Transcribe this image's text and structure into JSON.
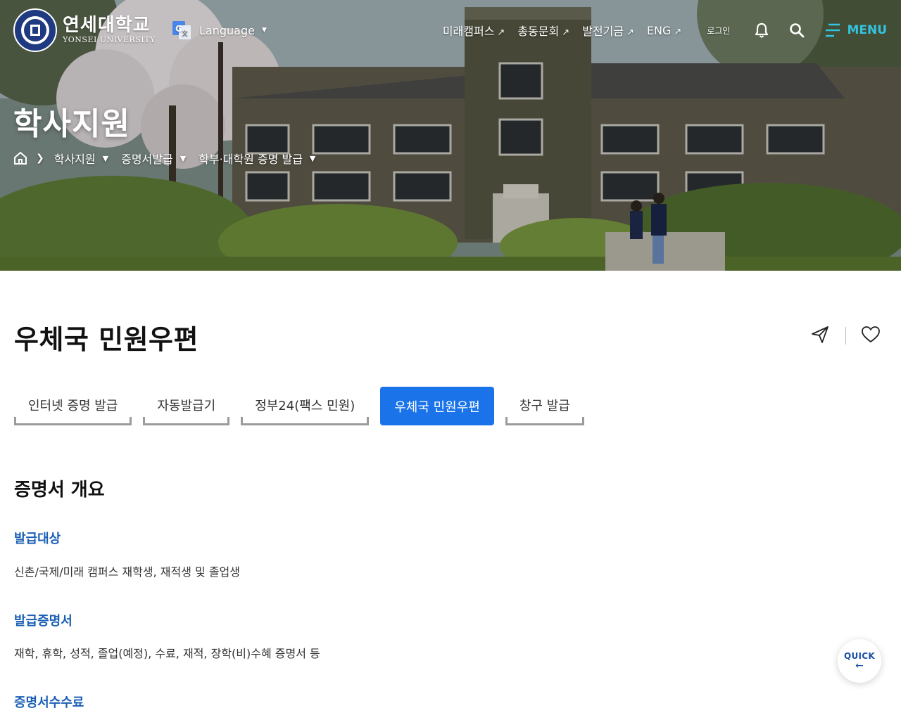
{
  "header": {
    "logo_ko": "연세대학교",
    "logo_en": "YONSEI UNIVERSITY",
    "language_label": "Language",
    "util_links": [
      {
        "label": "미래캠퍼스"
      },
      {
        "label": "총동문회"
      },
      {
        "label": "발전기금"
      },
      {
        "label": "ENG"
      }
    ],
    "login_label": "로그인",
    "menu_label": "MENU",
    "external_arrow": "↗"
  },
  "hero": {
    "title": "학사지원",
    "breadcrumb": [
      "학사지원",
      "증명서발급",
      "학부·대학원 증명 발급"
    ]
  },
  "page": {
    "title": "우체국 민원우편"
  },
  "tabs": [
    {
      "label": "인터넷 증명 발급",
      "active": false
    },
    {
      "label": "자동발급기",
      "active": false
    },
    {
      "label": "정부24(팩스 민원)",
      "active": false
    },
    {
      "label": "우체국 민원우편",
      "active": true
    },
    {
      "label": "창구 발급",
      "active": false
    }
  ],
  "content": {
    "section_title": "증명서 개요",
    "blocks": [
      {
        "heading": "발급대상",
        "text": "신촌/국제/미래 캠퍼스 재학생, 재적생 및 졸업생"
      },
      {
        "heading": "발급증명서",
        "text": "재학, 휴학, 성적, 졸업(예정), 수료, 재적, 장학(비)수혜 증명서 등"
      },
      {
        "heading": "증명서수수료",
        "text": ""
      }
    ]
  },
  "quick": {
    "label": "QUICK",
    "arrow": "←"
  },
  "colors": {
    "accent_blue": "#1a73e8",
    "heading_blue": "#1b5fb4",
    "menu_cyan": "#34c3e0",
    "quick_navy": "#1a4fa8"
  },
  "icons": [
    "university-seal-icon",
    "translate-icon",
    "bell-icon",
    "search-icon",
    "menu-icon",
    "home-icon",
    "share-icon",
    "heart-icon"
  ]
}
